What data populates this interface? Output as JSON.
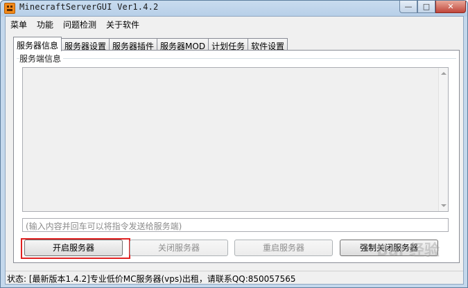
{
  "window": {
    "title": "MinecraftServerGUI Ver1.4.2",
    "controls": {
      "minimize": "—",
      "maximize": "□",
      "close": "✕"
    }
  },
  "menu": [
    "菜单",
    "功能",
    "问题检测",
    "关于软件"
  ],
  "tabs": [
    "服务器信息",
    "服务器设置",
    "服务器插件",
    "服务器MOD",
    "计划任务",
    "软件设置"
  ],
  "active_tab": "服务器信息",
  "panel": {
    "group_label": "服务端信息",
    "command_placeholder": "(输入内容并回车可以将指令发送给服务端)"
  },
  "buttons": {
    "start": "开启服务器",
    "stop": "关闭服务器",
    "restart": "重启服务器",
    "force_stop": "强制关闭服务器"
  },
  "status": "状态: [最新版本1.4.2]专业低价MC服务器(vps)出租，请联系QQ:850057565",
  "watermark": "Bai 经验",
  "colors": {
    "highlight": "#e02020"
  }
}
